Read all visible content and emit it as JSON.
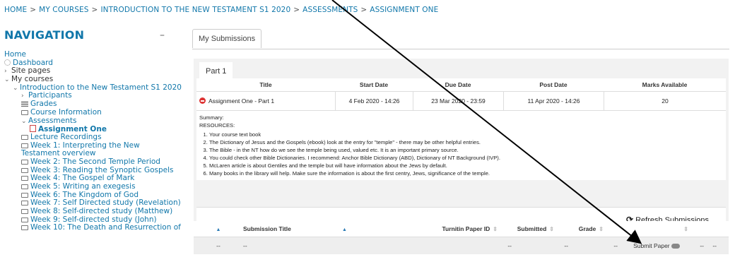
{
  "breadcrumb": [
    "HOME",
    "MY COURSES",
    "INTRODUCTION TO THE NEW TESTAMENT S1 2020",
    "ASSESSMENTS",
    "ASSIGNMENT ONE"
  ],
  "nav": {
    "title": "NAVIGATION",
    "collapse": "–",
    "home": "Home",
    "dashboard": "Dashboard",
    "site_pages": "Site pages",
    "my_courses": "My courses",
    "course": "Introduction to the New Testament S1 2020",
    "participants": "Participants",
    "grades": "Grades",
    "course_info": "Course Information",
    "assessments": "Assessments",
    "assignment_one": "Assignment One",
    "lecture_recordings": "Lecture Recordings",
    "weeks": [
      "Week 1: Interpreting the New Testament overview",
      "Week 2: The Second Temple Period",
      "Week 3: Reading the Synoptic Gospels",
      "Week 4: The Gospel of Mark",
      "Week 5: Writing an exegesis",
      "Week 6: The Kingdom of God",
      "Week 7: Self Directed study (Revelation)",
      "Week 8: Self-directed study (Matthew)",
      "Week 9: Self-directed study (John)",
      "Week 10: The Death and Resurrection of"
    ]
  },
  "tabs": {
    "my_submissions": "My Submissions",
    "part1": "Part 1"
  },
  "parts_table": {
    "headers": [
      "Title",
      "Start Date",
      "Due Date",
      "Post Date",
      "Marks Available"
    ],
    "row": [
      "Assignment One - Part 1",
      "4 Feb 2020 - 14:26",
      "23 Mar 2020 - 23:59",
      "11 Apr 2020 - 14:26",
      "20"
    ]
  },
  "summary": {
    "label": "Summary:",
    "resources": "RESOURCES:",
    "items": [
      "Your course text book",
      "The Dictionary of Jesus and the Gospels (ebook) look at the entry for \"temple\" - there may be other helpful entries.",
      "The Bible - in the NT how do we see the temple being used, valued etc. It is an important primary source.",
      "You could check other Bible Dictionaries. I recommend: Anchor Bible Dictionary (ABD), Dictionary of NT Background (IVP).",
      "McLaren article is about Gentiles and the temple but will have information about the Jews by default.",
      "Many books in the library will help. Make sure the information is about the first centry, Jews, significance of the temple."
    ]
  },
  "refresh_label": "Refresh Submissions",
  "submissions": {
    "headers": [
      "Submission Title",
      "Turnitin Paper ID",
      "Submitted",
      "Grade"
    ],
    "row": [
      "--",
      "--",
      "--",
      "--",
      "--",
      "Submit Paper",
      "--",
      "--"
    ]
  }
}
